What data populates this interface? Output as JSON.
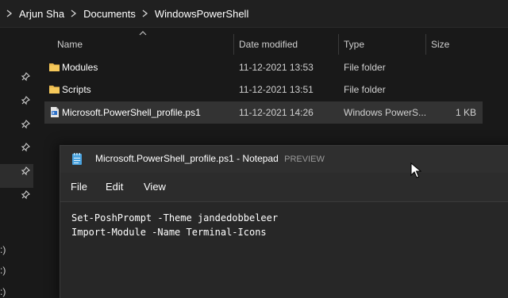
{
  "breadcrumb": {
    "segments": [
      "Arjun Sha",
      "Documents",
      "WindowsPowerShell"
    ]
  },
  "file_list": {
    "columns": {
      "name": "Name",
      "date_modified": "Date modified",
      "type": "Type",
      "size": "Size"
    },
    "rows": [
      {
        "name": "Modules",
        "date_modified": "11-12-2021 13:53",
        "type": "File folder",
        "size": "",
        "icon": "folder-icon"
      },
      {
        "name": "Scripts",
        "date_modified": "11-12-2021 13:51",
        "type": "File folder",
        "size": "",
        "icon": "folder-icon"
      },
      {
        "name": "Microsoft.PowerShell_profile.ps1",
        "date_modified": "11-12-2021 14:26",
        "type": "Windows PowerS...",
        "size": "1 KB",
        "icon": "ps1-file-icon",
        "selected": true
      }
    ]
  },
  "nav_pane": {
    "drive_labels": [
      ":)",
      ":)",
      ":)"
    ]
  },
  "notepad": {
    "title": "Microsoft.PowerShell_profile.ps1 - Notepad",
    "preview_badge": "PREVIEW",
    "menu": [
      "File",
      "Edit",
      "View"
    ],
    "content_lines": [
      "Set-PoshPrompt -Theme jandedobbeleer",
      "Import-Module -Name Terminal-Icons"
    ]
  },
  "colors": {
    "folder": "#e8b64c",
    "window_bg": "#191919",
    "selection": "#333333",
    "notepad_icon": "#4aa3df"
  }
}
